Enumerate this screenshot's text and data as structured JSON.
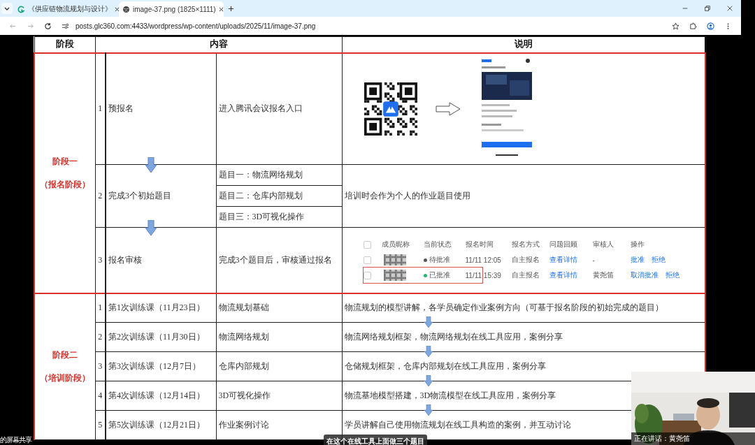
{
  "browser": {
    "tabs": [
      {
        "title": "《供应链物流规划与设计》",
        "selected": false
      },
      {
        "title": "image-37.png (1825×1111)",
        "selected": true
      }
    ],
    "url": "posts.glc360.com:4433/wordpress/wp-content/uploads/2025/11/image-37.png"
  },
  "table": {
    "columns": [
      "阶段",
      "内容",
      "说明"
    ],
    "stages": [
      {
        "name": "阶段一",
        "subtitle": "（报名阶段）",
        "rows": [
          {
            "kind": "qr",
            "no": "1",
            "title": "预报名",
            "content": [
              "进入腾讯会议报名入口"
            ]
          },
          {
            "kind": "topics",
            "no": "2",
            "title": "完成3个初始题目",
            "content": [
              "题目一：物流网络规划",
              "题目二：仓库内部规划",
              "题目三：3D可视化操作"
            ],
            "note": "培训时会作为个人的作业题目使用"
          },
          {
            "kind": "approval",
            "no": "3",
            "title": "报名审核",
            "content": [
              "完成3个题目后，审核通过报名"
            ],
            "approval": {
              "columns": [
                "成员昵称",
                "当前状态",
                "报名时间",
                "报名方式",
                "问题回顾",
                "审核人",
                "操作"
              ],
              "select_all_checked": false,
              "rows": [
                {
                  "checked": false,
                  "status": "待批准",
                  "approved": false,
                  "time": "11/11 12:05",
                  "method": "自主报名",
                  "detail": "查看详情",
                  "reviewer": "-",
                  "actions": [
                    "批准",
                    "拒绝"
                  ],
                  "highlighted": false
                },
                {
                  "checked": false,
                  "status": "已批准",
                  "approved": true,
                  "time": "11/11 15:39",
                  "method": "自主报名",
                  "detail": "查看详情",
                  "reviewer": "黄尧笛",
                  "actions": [
                    "取消批准",
                    "拒绝"
                  ],
                  "highlighted": true
                }
              ]
            }
          }
        ]
      },
      {
        "name": "阶段二",
        "subtitle": "（培训阶段）",
        "rows": [
          {
            "kind": "lesson",
            "no": "1",
            "title": "第1次训练课（11月23日）",
            "content": [
              "物流规划基础"
            ],
            "note": "物流规划的模型讲解，各学员确定作业案例方向（可基于报名阶段的初始完成的题目）"
          },
          {
            "kind": "lesson",
            "no": "2",
            "title": "第2次训练课（11月30日）",
            "content": [
              "物流网络规划"
            ],
            "note": "物流网络规划框架，物流网络规划在线工具应用，案例分享"
          },
          {
            "kind": "lesson",
            "no": "3",
            "title": "第3次训练课（12月7日）",
            "content": [
              "仓库内部规划"
            ],
            "note": "仓储规划框架，仓库内部规划在线工具应用，案例分享"
          },
          {
            "kind": "lesson",
            "no": "4",
            "title": "第4次训练课（12月14日）",
            "content": [
              "3D可视化操作"
            ],
            "note": "物流基地模型搭建，3D物流模型在线工具应用，案例分享"
          },
          {
            "kind": "lesson",
            "no": "5",
            "title": "第5次训练课（12月21日）",
            "content": [
              "作业案例讨论"
            ],
            "note": "学员讲解自己使用物流规划在线工具构造的案例，并互动讨论"
          }
        ]
      }
    ]
  },
  "screen_share_label": "的屏幕共享",
  "subtitle": "在这个在线工具上面做三个题目",
  "speaker": {
    "label": "正在讲话：黄尧笛"
  }
}
